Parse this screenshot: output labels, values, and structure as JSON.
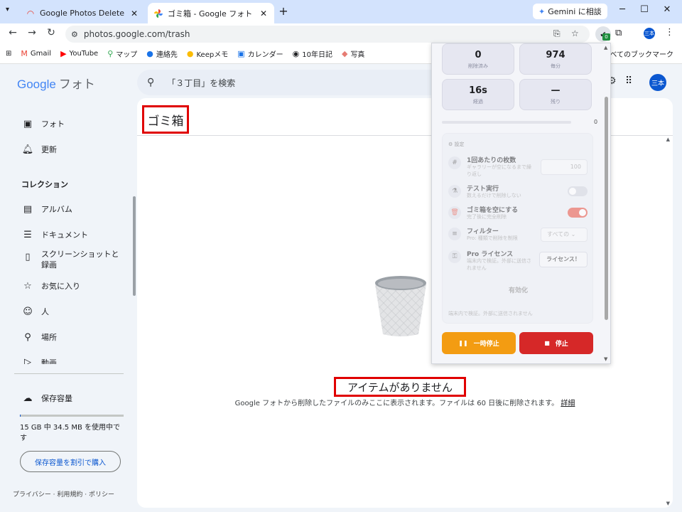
{
  "browser": {
    "tabs": [
      {
        "title": "Google Photos Delete Tool - Ch"
      },
      {
        "title": "ゴミ箱 - Google フォト"
      }
    ],
    "gemini_label": "Gemini に相談",
    "url": "photos.google.com/trash",
    "extension_badge": "0",
    "profile_initials": "三本"
  },
  "bookmarks": {
    "items": [
      "Gmail",
      "YouTube",
      "マップ",
      "連絡先",
      "Keepメモ",
      "カレンダー",
      "10年日記",
      "写真"
    ],
    "all_label": "すべてのブックマーク"
  },
  "photos": {
    "logo_google": "Google",
    "logo_product": "フォト",
    "search_placeholder": "「３丁目」を検索",
    "avatar": "三本",
    "sidebar": {
      "items": [
        {
          "label": "フォト",
          "icon": "photo-icon"
        },
        {
          "label": "更新",
          "icon": "bell-icon"
        }
      ],
      "collections_header": "コレクション",
      "collections": [
        {
          "label": "アルバム",
          "icon": "album-icon"
        },
        {
          "label": "ドキュメント",
          "icon": "document-icon"
        },
        {
          "label": "スクリーンショットと録画",
          "icon": "screenshot-icon"
        },
        {
          "label": "お気に入り",
          "icon": "star-icon"
        },
        {
          "label": "人",
          "icon": "face-icon"
        },
        {
          "label": "場所",
          "icon": "pin-icon"
        },
        {
          "label": "動画",
          "icon": "video-icon"
        }
      ],
      "storage_label": "保存容量",
      "storage_usage": "15 GB 中 34.5 MB を使用中です",
      "storage_fraction": 0.002,
      "buy_button": "保存容量を割引で購入",
      "footer": "プライバシー · 利用規約 · ポリシー"
    },
    "main": {
      "title": "ゴミ箱",
      "empty_title": "アイテムがありません",
      "empty_desc": "Google フォトから削除したファイルのみここに表示されます。ファイルは 60 日後に削除されます。",
      "detail_link": "詳細"
    }
  },
  "popup": {
    "stats": [
      {
        "value": "0",
        "label": "削除済み"
      },
      {
        "value": "974",
        "label": "毎分"
      },
      {
        "value": "16s",
        "label": "経過"
      },
      {
        "value": "—",
        "label": "残り"
      }
    ],
    "progress_value": "0",
    "settings_header": "設定",
    "rows": [
      {
        "title": "1回あたりの枚数",
        "sub": "ギャラリーが空になるまで繰り返し",
        "value": "100"
      },
      {
        "title": "テスト実行",
        "sub": "数えるだけで削除しない",
        "toggle": false
      },
      {
        "title": "ゴミ箱を空にする",
        "sub": "完了後に完全削除",
        "toggle": true
      },
      {
        "title": "フィルター",
        "sub": "Pro: 種類で削除を制限",
        "select": "すべての"
      },
      {
        "title": "Pro ライセンス",
        "sub": "端末内で検証。外部に送信されません",
        "button": "ライセンス！"
      }
    ],
    "activate": "有効化",
    "local_note": "端末内で検証。外部に送信されません",
    "pause_button": "一時停止",
    "stop_button": "停止"
  }
}
